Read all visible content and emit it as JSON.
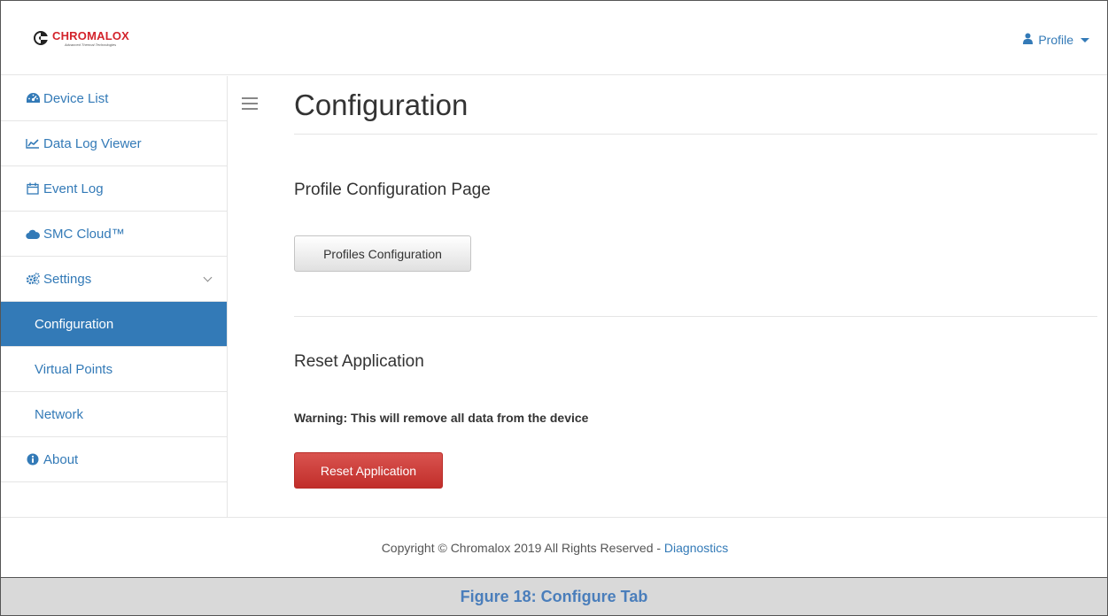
{
  "navbar": {
    "logo_text": "CHROMALOX",
    "logo_tagline": "Advanced Thermal Technologies",
    "profile_label": "Profile"
  },
  "sidebar": {
    "items": [
      {
        "label": "Device List",
        "icon": "dashboard-icon"
      },
      {
        "label": "Data Log Viewer",
        "icon": "line-chart-icon"
      },
      {
        "label": "Event Log",
        "icon": "calendar-icon"
      },
      {
        "label": "SMC Cloud™",
        "icon": "cloud-icon"
      },
      {
        "label": "Settings",
        "icon": "cogs-icon"
      },
      {
        "label": "Configuration",
        "active": true
      },
      {
        "label": "Virtual Points"
      },
      {
        "label": "Network"
      },
      {
        "label": "About",
        "icon": "info-circle-icon"
      }
    ]
  },
  "main": {
    "title": "Configuration",
    "profile_section_heading": "Profile Configuration Page",
    "profiles_button": "Profiles Configuration",
    "reset_section_heading": "Reset Application",
    "warning": "Warning: This will remove all data from the device",
    "reset_button": "Reset Application"
  },
  "footer": {
    "text": "Copyright © Chromalox 2019 All Rights Reserved - ",
    "link": "Diagnostics"
  },
  "caption": "Figure 18: Configure Tab",
  "colors": {
    "accent": "#337ab7",
    "danger": "#d9534f",
    "brand": "#d3232b",
    "caption_text": "#4a7ebb"
  }
}
